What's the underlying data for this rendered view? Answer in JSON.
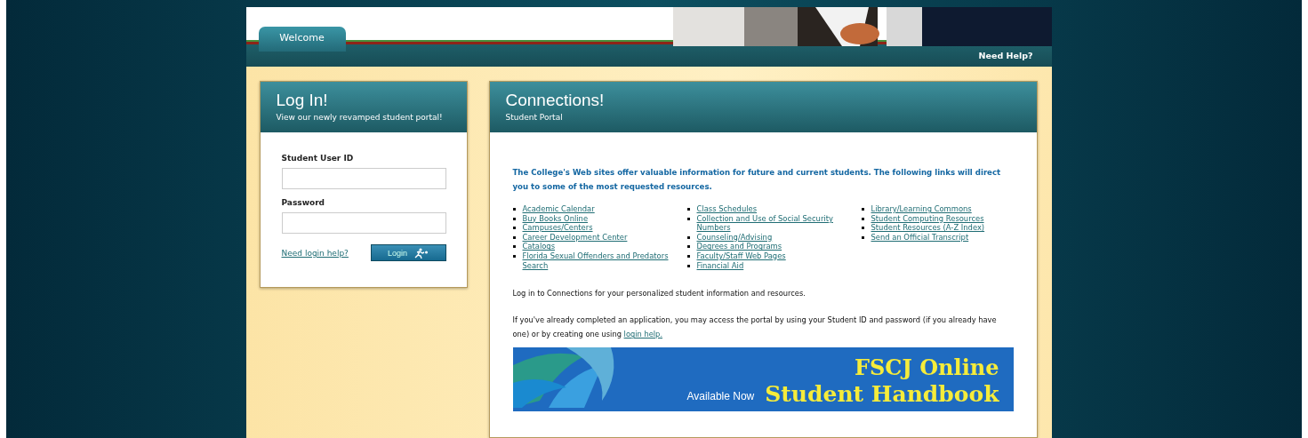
{
  "header": {
    "tabs": [
      {
        "label": "Welcome",
        "selected": true
      }
    ],
    "help_link": "Need Help?"
  },
  "login": {
    "title": "Log In!",
    "subtitle": "View our newly revamped student portal!",
    "fields": [
      {
        "label": "Student User ID"
      },
      {
        "label": "Password"
      }
    ],
    "help_link": "Need login help?",
    "button": "Login"
  },
  "connections": {
    "title": "Connections!",
    "subtitle": "Student Portal",
    "intro": "The College's Web sites offer valuable information for future and current students. The following links will direct you to some of the most requested resources.",
    "link_columns": [
      [
        "Academic Calendar",
        "Buy Books Online",
        "Campuses/Centers",
        "Career Development Center",
        "Catalogs",
        "Florida Sexual Offenders and Predators Search"
      ],
      [
        "Class Schedules",
        "Collection and Use of Social Security Numbers",
        "Counseling/Advising",
        "Degrees and Programs",
        "Faculty/Staff Web Pages",
        "Financial Aid"
      ],
      [
        "Library/Learning Commons",
        "Student Computing Resources",
        "Student Resources (A-Z Index)",
        "Send an Official Transcript"
      ]
    ],
    "note": "Log in to Connections for your personalized student information and resources.",
    "paragraph": "If you've already completed an application, you may access the portal by using your Student ID and password (if you already have one) or by creating one using",
    "paragraph_link": "login help.",
    "banner": {
      "tagline": "Available Now",
      "title_line_1": "FSCJ Online",
      "title_line_2": "Student Handbook"
    }
  }
}
